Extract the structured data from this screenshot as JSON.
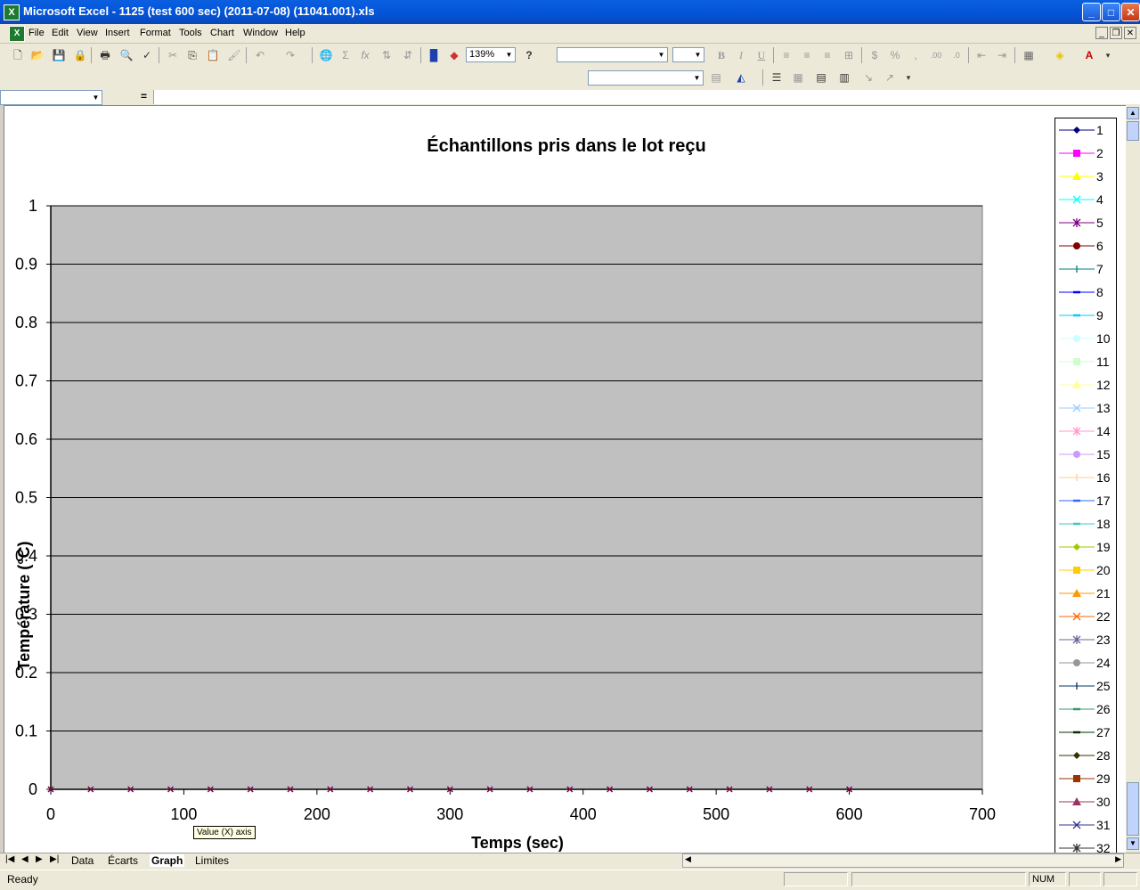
{
  "window": {
    "title": "Microsoft Excel - 1125 (test 600 sec) (2011-07-08) (11041.001).xls",
    "minimize": "_",
    "maximize": "□",
    "close": "✕"
  },
  "menu": [
    "File",
    "Edit",
    "View",
    "Insert",
    "Format",
    "Tools",
    "Chart",
    "Window",
    "Help"
  ],
  "toolbar": {
    "zoom": "139%",
    "help_label": "?"
  },
  "namebox": {
    "value": "",
    "formula_sign": "="
  },
  "sheet_tabs": [
    "Data",
    "Écarts",
    "Graph",
    "Limites"
  ],
  "active_tab": "Graph",
  "status": {
    "ready": "Ready",
    "num": "NUM"
  },
  "tooltip": "Value (X) axis",
  "chart_data": {
    "type": "scatter",
    "title": "Échantillons pris dans le lot reçu",
    "xlabel": "Temps (sec)",
    "ylabel": "Température (°C)",
    "xlim": [
      0,
      700
    ],
    "ylim": [
      0,
      1
    ],
    "x_ticks": [
      "0",
      "100",
      "200",
      "300",
      "400",
      "500",
      "600",
      "700"
    ],
    "y_ticks": [
      "0",
      "0.1",
      "0.2",
      "0.3",
      "0.4",
      "0.5",
      "0.6",
      "0.7",
      "0.8",
      "0.9",
      "1"
    ],
    "plot_background": "#c0c0c0",
    "grid": true,
    "legend_position": "right",
    "x": [
      0,
      30,
      60,
      90,
      120,
      150,
      180,
      210,
      240,
      270,
      300,
      330,
      360,
      390,
      420,
      450,
      480,
      510,
      540,
      570,
      600
    ],
    "y": [
      0,
      0,
      0,
      0,
      0,
      0,
      0,
      0,
      0,
      0,
      0,
      0,
      0,
      0,
      0,
      0,
      0,
      0,
      0,
      0,
      0
    ],
    "series": [
      {
        "name": "1",
        "color": "#000080",
        "marker": "diamond"
      },
      {
        "name": "2",
        "color": "#ff00ff",
        "marker": "square"
      },
      {
        "name": "3",
        "color": "#ffff00",
        "marker": "triangle"
      },
      {
        "name": "4",
        "color": "#00ffff",
        "marker": "x"
      },
      {
        "name": "5",
        "color": "#800080",
        "marker": "star"
      },
      {
        "name": "6",
        "color": "#800000",
        "marker": "circle"
      },
      {
        "name": "7",
        "color": "#008080",
        "marker": "plus"
      },
      {
        "name": "8",
        "color": "#0000ff",
        "marker": "dash"
      },
      {
        "name": "9",
        "color": "#00ccff",
        "marker": "dash"
      },
      {
        "name": "10",
        "color": "#ccffff",
        "marker": "circle"
      },
      {
        "name": "11",
        "color": "#ccffcc",
        "marker": "square"
      },
      {
        "name": "12",
        "color": "#ffff99",
        "marker": "triangle"
      },
      {
        "name": "13",
        "color": "#99ccff",
        "marker": "x"
      },
      {
        "name": "14",
        "color": "#ff99cc",
        "marker": "star"
      },
      {
        "name": "15",
        "color": "#cc99ff",
        "marker": "circle"
      },
      {
        "name": "16",
        "color": "#ffcc99",
        "marker": "plus"
      },
      {
        "name": "17",
        "color": "#3366ff",
        "marker": "dash"
      },
      {
        "name": "18",
        "color": "#33cccc",
        "marker": "dash"
      },
      {
        "name": "19",
        "color": "#99cc00",
        "marker": "diamond"
      },
      {
        "name": "20",
        "color": "#ffcc00",
        "marker": "square"
      },
      {
        "name": "21",
        "color": "#ff9900",
        "marker": "triangle"
      },
      {
        "name": "22",
        "color": "#ff6600",
        "marker": "x"
      },
      {
        "name": "23",
        "color": "#666699",
        "marker": "star"
      },
      {
        "name": "24",
        "color": "#969696",
        "marker": "circle"
      },
      {
        "name": "25",
        "color": "#003366",
        "marker": "plus"
      },
      {
        "name": "26",
        "color": "#339966",
        "marker": "dash"
      },
      {
        "name": "27",
        "color": "#003300",
        "marker": "dash"
      },
      {
        "name": "28",
        "color": "#333300",
        "marker": "diamond"
      },
      {
        "name": "29",
        "color": "#993300",
        "marker": "square"
      },
      {
        "name": "30",
        "color": "#993366",
        "marker": "triangle"
      },
      {
        "name": "31",
        "color": "#333399",
        "marker": "x"
      },
      {
        "name": "32",
        "color": "#333333",
        "marker": "star"
      }
    ]
  }
}
